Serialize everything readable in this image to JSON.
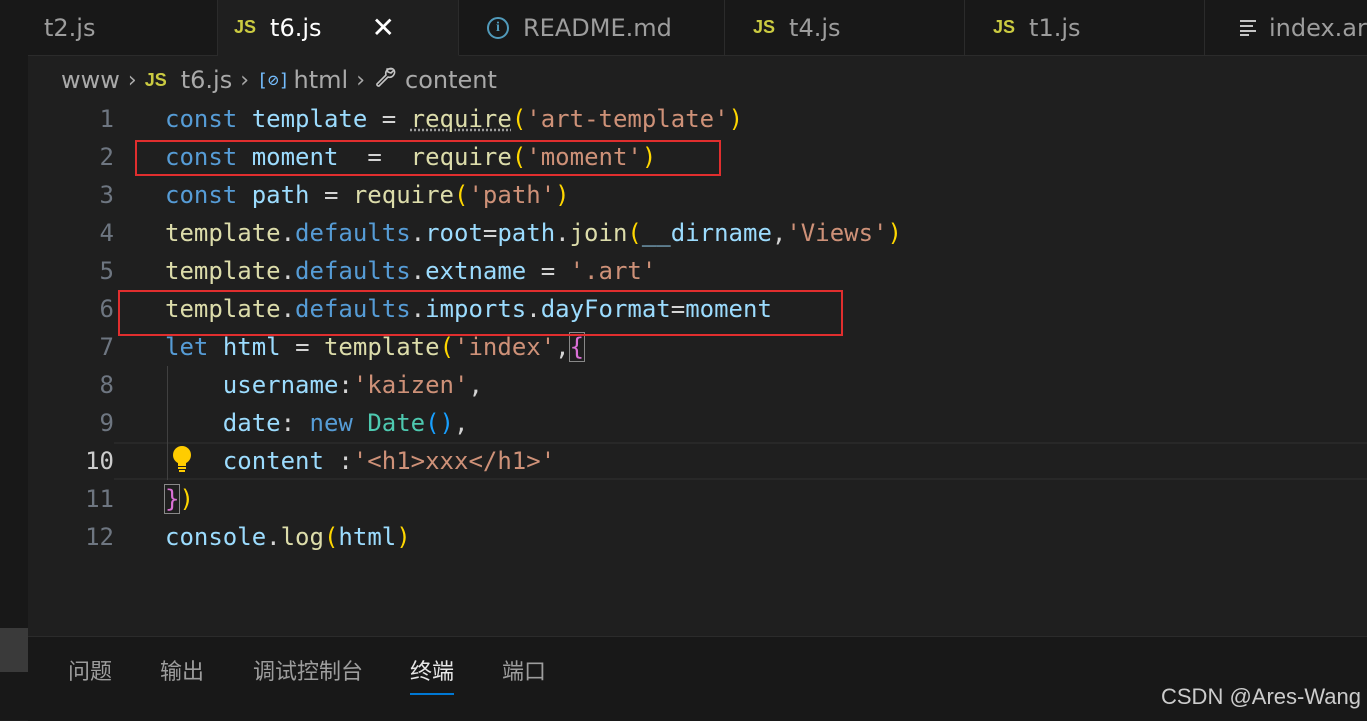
{
  "tabs": [
    {
      "label": "t2.js",
      "icon": "none",
      "active": false
    },
    {
      "label": "t6.js",
      "icon": "js-icon",
      "active": true
    },
    {
      "label": "README.md",
      "icon": "info-icon",
      "active": false
    },
    {
      "label": "t4.js",
      "icon": "js-icon",
      "active": false
    },
    {
      "label": "t1.js",
      "icon": "js-icon",
      "active": false
    },
    {
      "label": "index.art",
      "icon": "lines-icon",
      "active": false
    }
  ],
  "tab_icon_text": {
    "js": "JS",
    "info": "i"
  },
  "breadcrumb": {
    "folder": "www",
    "file": "t6.js",
    "file_icon": "JS",
    "variable_icon": "[⊘]",
    "variable": "html",
    "property": "content"
  },
  "line_numbers": [
    "1",
    "2",
    "3",
    "4",
    "5",
    "6",
    "7",
    "8",
    "9",
    "10",
    "11",
    "12"
  ],
  "current_line": "10",
  "code": {
    "l1": [
      "const",
      "template",
      "=",
      "require",
      "(",
      "'art-template'",
      ")"
    ],
    "l2": [
      "const",
      "moment",
      "=",
      "require",
      "(",
      "'moment'",
      ")"
    ],
    "l3": [
      "const",
      "path",
      "=",
      "require",
      "(",
      "'path'",
      ")"
    ],
    "l4": [
      "template",
      ".",
      "defaults",
      ".",
      "root",
      "=",
      "path",
      ".",
      "join",
      "(",
      "__dirname",
      ",",
      "'Views'",
      ")"
    ],
    "l5": [
      "template",
      ".",
      "defaults",
      ".",
      "extname",
      "=",
      "'.art'"
    ],
    "l6": [
      "template",
      ".",
      "defaults",
      ".",
      "imports",
      ".",
      "dayFormat",
      "=",
      "moment"
    ],
    "l7": [
      "let",
      "html",
      "=",
      "template",
      "(",
      "'index'",
      ",",
      "{"
    ],
    "l8": [
      "username",
      ":",
      "'kaizen'",
      ","
    ],
    "l9": [
      "date",
      ":",
      "new",
      "Date",
      "()",
      ","
    ],
    "l10": [
      "content",
      ":",
      "'<h1>xxx</h1>'"
    ],
    "l11": [
      "}",
      ")"
    ],
    "l12": [
      "console",
      ".",
      "log",
      "(",
      "html",
      ")"
    ]
  },
  "panel_tabs": [
    "问题",
    "输出",
    "调试控制台",
    "终端",
    "端口"
  ],
  "panel_active_tab": "终端",
  "watermark": "CSDN @Ares-Wang",
  "colors": {
    "keyword": "#569cd6",
    "variable": "#9cdcfe",
    "function": "#dcdcaa",
    "string": "#ce9178",
    "type": "#4ec9b0",
    "bracket_level1": "#ffd700",
    "bracket_level2": "#da70d6",
    "bracket_level3": "#179fff",
    "highlight_box": "#e02e2e",
    "accent": "#0078d4"
  }
}
